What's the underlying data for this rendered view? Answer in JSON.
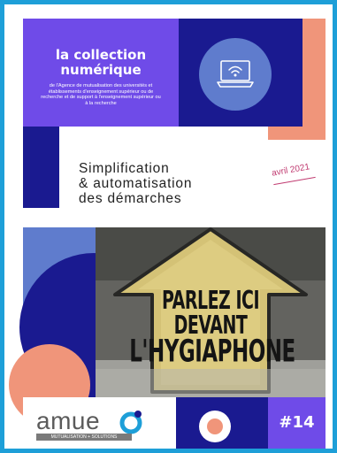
{
  "header": {
    "title_line1": "la collection",
    "title_line2": "numérique",
    "description": "de l'Agence de mutualisation des universités et établissements d'enseignement supérieur ou de recherche et de support à l'enseignement supérieur ou à la recherche"
  },
  "publication": {
    "title_line1": "Simplification",
    "title_line2": "& automatisation",
    "title_line3": "des démarches",
    "date": "avril 2021",
    "issue": "#14"
  },
  "photo": {
    "line1": "PARLEZ ICI",
    "line2": "DEVANT",
    "line3": "L'HYGIAPHONE"
  },
  "logo": {
    "name": "amue",
    "tagline": "MUTUALISATION + SOLUTIONS"
  },
  "colors": {
    "frame_blue": "#1e9fd8",
    "purple": "#6f4be8",
    "navy": "#1a1a90",
    "salmon": "#f0957a",
    "periwinkle": "#5f7ccd",
    "date_pink": "#c03a70"
  },
  "icons": [
    "laptop-wifi-icon",
    "amue-logo-mark-icon"
  ]
}
